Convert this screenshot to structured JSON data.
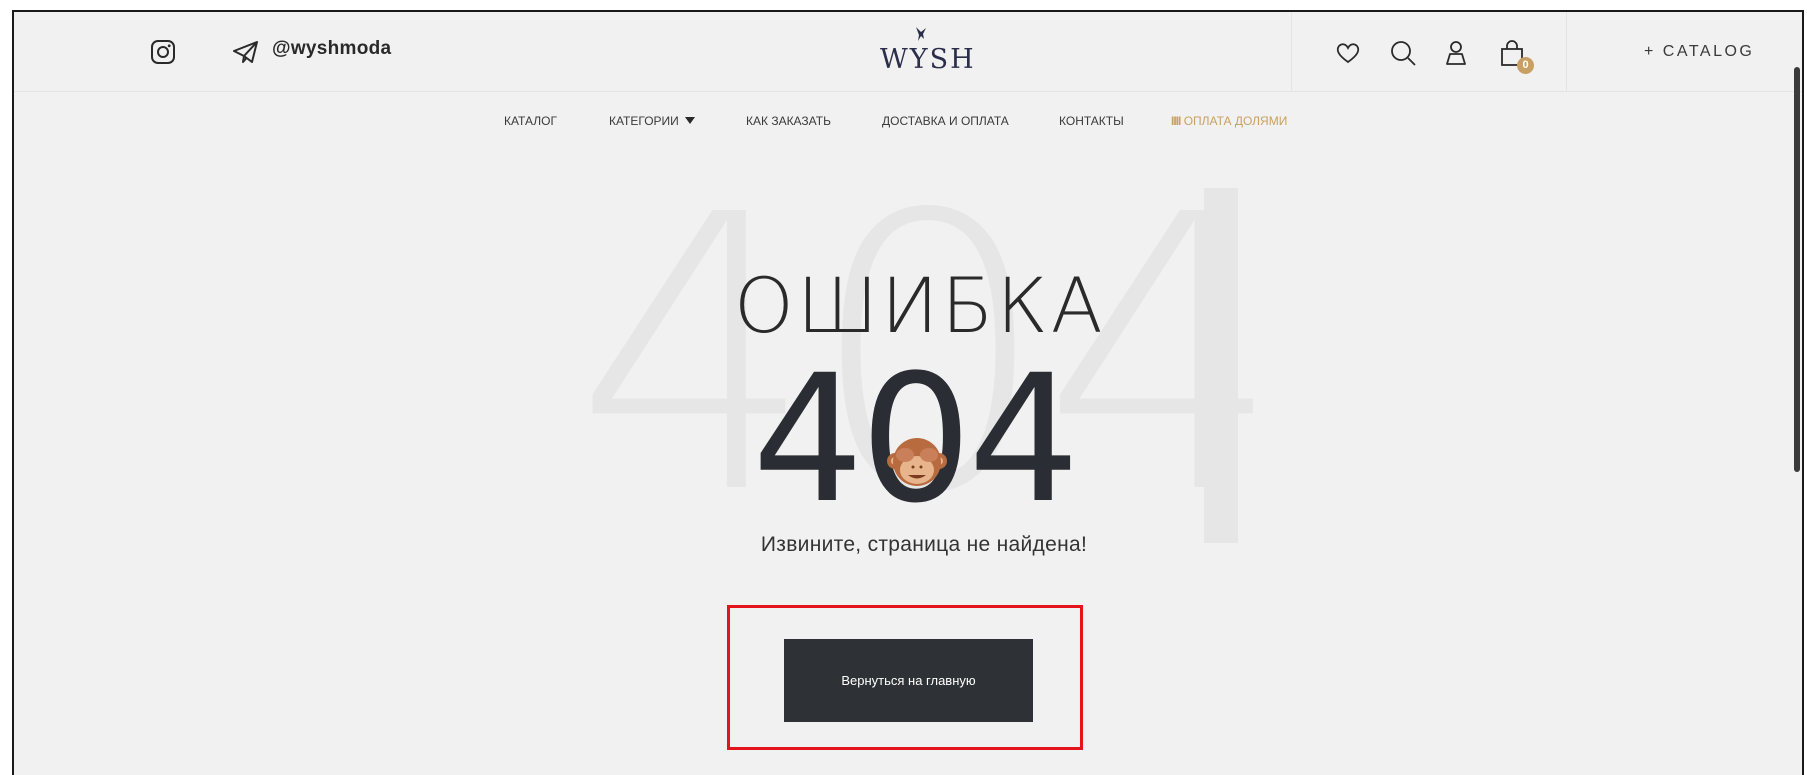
{
  "header": {
    "telegram_handle": "@wyshmoda",
    "logo_text": "WYSH",
    "cart_count": "0",
    "catalog_link": "+ CATALOG"
  },
  "nav": {
    "items": [
      {
        "label": "КАТАЛОГ"
      },
      {
        "label": "КАТЕГОРИИ"
      },
      {
        "label": "КАК ЗАКАЗАТЬ"
      },
      {
        "label": "ДОСТАВКА И ОПЛАТА"
      },
      {
        "label": "КОНТАКТЫ"
      },
      {
        "label": "ОПЛАТА ДОЛЯМИ"
      }
    ],
    "promo_glyph": "IIII"
  },
  "error": {
    "background_code": "404",
    "title": "ОШИБКА",
    "code": "404",
    "message": "Извините, страница не найдена!",
    "button_label": "Вернуться на главную"
  },
  "colors": {
    "accent": "#c9a063",
    "button_bg": "#2e3135",
    "highlight": "#e3141b",
    "logo": "#2b2e4a"
  },
  "icons": [
    "instagram-icon",
    "telegram-icon",
    "heart-icon",
    "search-icon",
    "user-icon",
    "shopping-bag-icon",
    "monkey-emoji-icon",
    "caret-down-icon"
  ]
}
